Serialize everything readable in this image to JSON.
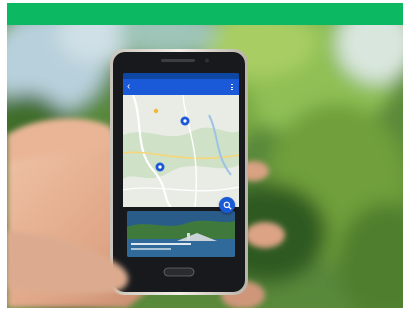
{
  "photo": {
    "subject": "hand-holding-smartphone",
    "banner_color": "#0db863",
    "background_color": "#5c8a3a"
  },
  "app": {
    "title": "",
    "primary_color": "#1a5ad9",
    "icons": [
      "back-arrow-icon",
      "menu-icon",
      "map-pin-icon",
      "search-icon"
    ]
  }
}
